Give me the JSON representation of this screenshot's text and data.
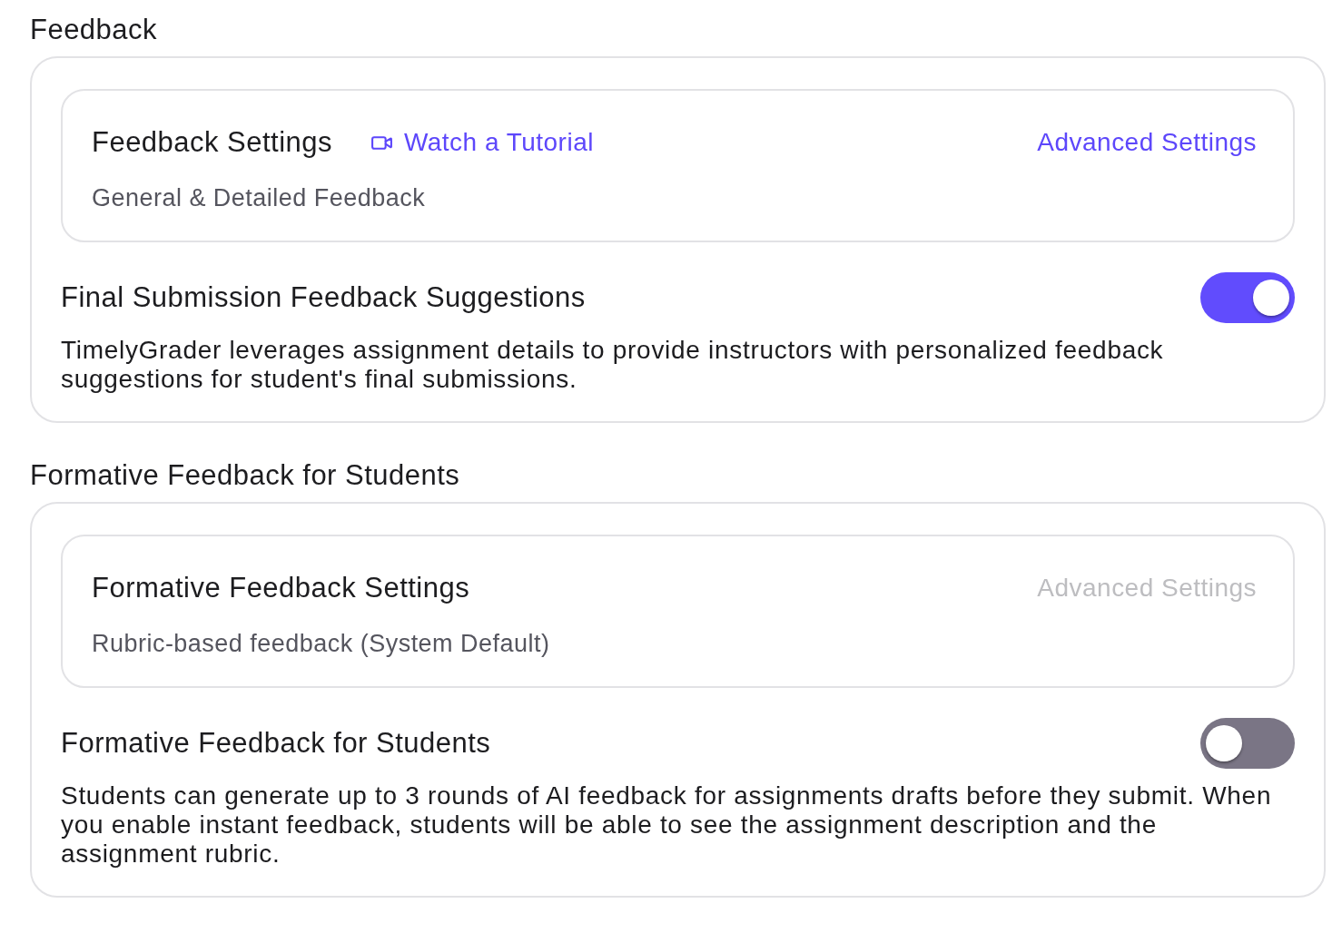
{
  "sections": [
    {
      "title": "Feedback",
      "settings_card": {
        "title": "Feedback Settings",
        "tutorial_link": {
          "label": "Watch a Tutorial"
        },
        "advanced_link": {
          "label": "Advanced Settings",
          "disabled": false
        },
        "subtitle": "General & Detailed Feedback"
      },
      "toggle": {
        "label": "Final Submission Feedback Suggestions",
        "on": true,
        "description": "TimelyGrader leverages assignment details to provide instructors with personalized feedback suggestions for student's final submissions."
      }
    },
    {
      "title": "Formative Feedback for Students",
      "settings_card": {
        "title": "Formative Feedback Settings",
        "advanced_link": {
          "label": "Advanced Settings",
          "disabled": true
        },
        "subtitle": "Rubric-based feedback (System Default)"
      },
      "toggle": {
        "label": "Formative Feedback for Students",
        "on": false,
        "description": "Students can generate up to 3 rounds of AI feedback for assignments drafts before they submit. When you enable instant feedback, students will be able to see the assignment description and the assignment rubric."
      }
    }
  ]
}
